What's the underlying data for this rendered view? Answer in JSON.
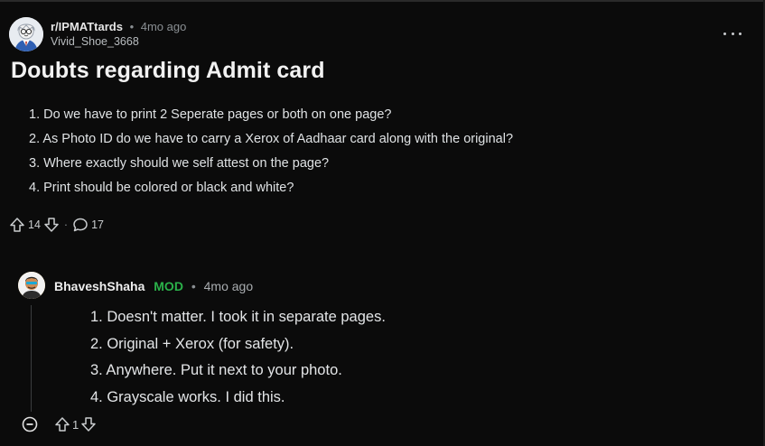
{
  "post": {
    "subreddit": "r/IPMATtards",
    "separator": "•",
    "time": "4mo ago",
    "author": "Vivid_Shoe_3668",
    "title": "Doubts regarding Admit card",
    "body_items": [
      "1. Do we have to print 2 Seperate pages or both on one page?",
      "2. As Photo ID do we have to carry a Xerox of Aadhaar card along with the original?",
      "3. Where exactly should we self attest on the page?",
      "4. Print should be colored or black and white?"
    ],
    "upvotes": "14",
    "dot": "·",
    "comments": "17",
    "icons": {
      "avatar": "subreddit-avatar-icon",
      "overflow": "more-options-icon",
      "upvote": "upvote-arrow-icon",
      "downvote": "downvote-arrow-icon",
      "comment": "comment-bubble-icon"
    }
  },
  "comment": {
    "author": "BhaveshShaha",
    "mod_badge": "MOD",
    "separator": "•",
    "time": "4mo ago",
    "body_items": [
      "1. Doesn't matter. I took it in separate pages.",
      "2. Original + Xerox (for safety).",
      "3. Anywhere. Put it next to your photo.",
      "4. Grayscale works. I did this."
    ],
    "upvotes": "1",
    "icons": {
      "avatar": "user-avatar-icon",
      "collapse": "collapse-thread-icon",
      "upvote": "upvote-arrow-icon",
      "downvote": "downvote-arrow-icon"
    }
  },
  "colors": {
    "background": "#0b0b0b",
    "mod_green": "#2bb14a",
    "text_primary": "#d7dadc",
    "text_muted": "#8a8f93"
  }
}
